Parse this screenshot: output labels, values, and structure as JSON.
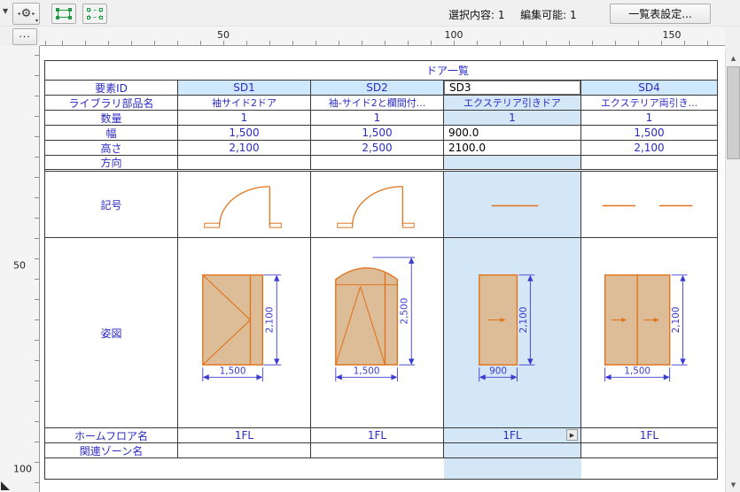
{
  "toolbar": {
    "collapse_arrow": "▼",
    "gear_left_arrow": "◂",
    "gear_icon": "⚙",
    "gear_right_arrow": "▸",
    "gear_dropdown": "▾",
    "status_selected_label": "選択内容:",
    "status_selected_value": "1",
    "status_editable_label": "編集可能:",
    "status_editable_value": "1",
    "settings_button_label": "一覧表設定...",
    "overflow_button_label": "..."
  },
  "ruler": {
    "h_marks": [
      "50",
      "100",
      "150"
    ],
    "v_marks": [
      "50",
      "100"
    ]
  },
  "scrollbar": {
    "up_arrow": "▲",
    "down_arrow": "▼"
  },
  "icons": {
    "flyout": "▶"
  },
  "schedule": {
    "title": "ドア一覧",
    "labels": {
      "id": "要素ID",
      "library": "ライブラリ部品名",
      "quantity": "数量",
      "width": "幅",
      "height": "高さ",
      "direction": "方向",
      "symbol": "記号",
      "elevation": "姿図",
      "floor": "ホームフロア名",
      "zone": "関連ゾーン名"
    },
    "columns": [
      {
        "id": "SD1",
        "library": "袖サイド2ドア",
        "quantity": "1",
        "width": "1,500",
        "height": "2,100",
        "floor": "1FL",
        "dim_width": "1,500",
        "dim_height": "2,100"
      },
      {
        "id": "SD2",
        "library": "袖-サイド2と欄間付...",
        "quantity": "1",
        "width": "1,500",
        "height": "2,500",
        "floor": "1FL",
        "dim_width": "1,500",
        "dim_height": "2,500"
      },
      {
        "id": "SD3",
        "library": "エクステリア引きドア",
        "quantity": "1",
        "width": "900.0",
        "height": "2100.0",
        "floor": "1FL",
        "dim_width": "900",
        "dim_height": "2,100"
      },
      {
        "id": "SD4",
        "library": "エクステリア両引き...",
        "quantity": "1",
        "width": "1,500",
        "height": "2,100",
        "floor": "1FL",
        "dim_width": "1,500",
        "dim_height": "2,100"
      }
    ]
  },
  "colors": {
    "text_blue": "#2b2bc4",
    "dim_blue": "#3c3cd2",
    "door_line_orange": "#e2731c",
    "door_fill_tan": "#dcbd98",
    "header_cell_bg": "#cfe8fd",
    "selected_column_bg": "#d3e7f7",
    "chrome_bg": "#f0f0f0"
  }
}
